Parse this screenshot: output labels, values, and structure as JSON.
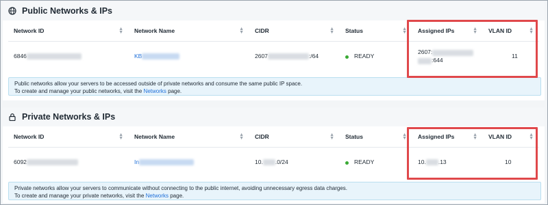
{
  "public": {
    "title": "Public Networks & IPs",
    "columns": [
      "Network ID",
      "Network Name",
      "CIDR",
      "Status",
      "Assigned IPs",
      "VLAN ID"
    ],
    "row": {
      "network_id": "6846",
      "network_name": "KB",
      "cidr_start": "2607",
      "cidr_end": ":/64",
      "status": "READY",
      "ip_line1": "2607:",
      "ip_line2_end": ":644",
      "vlan": "11"
    },
    "info_line1": "Public networks allow your servers to be accessed outside of private networks and consume the same public IP space.",
    "info_line2_pre": "To create and manage your public networks, visit the ",
    "info_link": "Networks",
    "info_line2_post": " page."
  },
  "private": {
    "title": "Private Networks & IPs",
    "columns": [
      "Network ID",
      "Network Name",
      "CIDR",
      "Status",
      "Assigned IPs",
      "VLAN ID"
    ],
    "row": {
      "network_id": "6092",
      "network_name": "In",
      "cidr_start": "10.",
      "cidr_end": ".0/24",
      "status": "READY",
      "ip_start": "10.",
      "ip_end": ".13",
      "vlan": "10"
    },
    "info_line1": "Private networks allow your servers to communicate without connecting to the public internet, avoiding unnecessary egress data charges.",
    "info_line2_pre": "To create and manage your private networks, visit the ",
    "info_link": "Networks",
    "info_line2_post": " page."
  },
  "colors": {
    "highlight": "#e0484b",
    "link": "#1e6fd9",
    "status_ready": "#3aaa35",
    "info_bg": "#e8f4fb"
  }
}
